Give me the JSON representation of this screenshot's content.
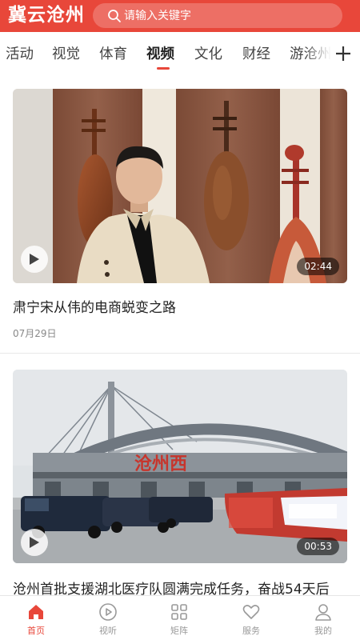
{
  "header": {
    "logo": "冀云沧州",
    "search_placeholder": "请输入关键字"
  },
  "tabs": [
    {
      "label": "活动"
    },
    {
      "label": "视觉"
    },
    {
      "label": "体育"
    },
    {
      "label": "视频",
      "active": true
    },
    {
      "label": "文化"
    },
    {
      "label": "财经"
    },
    {
      "label": "游沧州"
    }
  ],
  "feed": [
    {
      "title": "肃宁宋从伟的电商蜕变之路",
      "date": "07月29日",
      "duration": "02:44"
    },
    {
      "title": "沧州首批支援湖北医疗队圆满完成任务，奋战54天后",
      "duration": "00:53",
      "sign_text": "沧州西"
    }
  ],
  "bottom_nav": [
    {
      "label": "首页",
      "icon": "home-icon",
      "active": true
    },
    {
      "label": "视听",
      "icon": "play-circle-icon"
    },
    {
      "label": "矩阵",
      "icon": "grid-icon"
    },
    {
      "label": "服务",
      "icon": "heart-icon"
    },
    {
      "label": "我的",
      "icon": "user-icon"
    }
  ],
  "colors": {
    "brand": "#e8473a",
    "inactive": "#999999"
  }
}
